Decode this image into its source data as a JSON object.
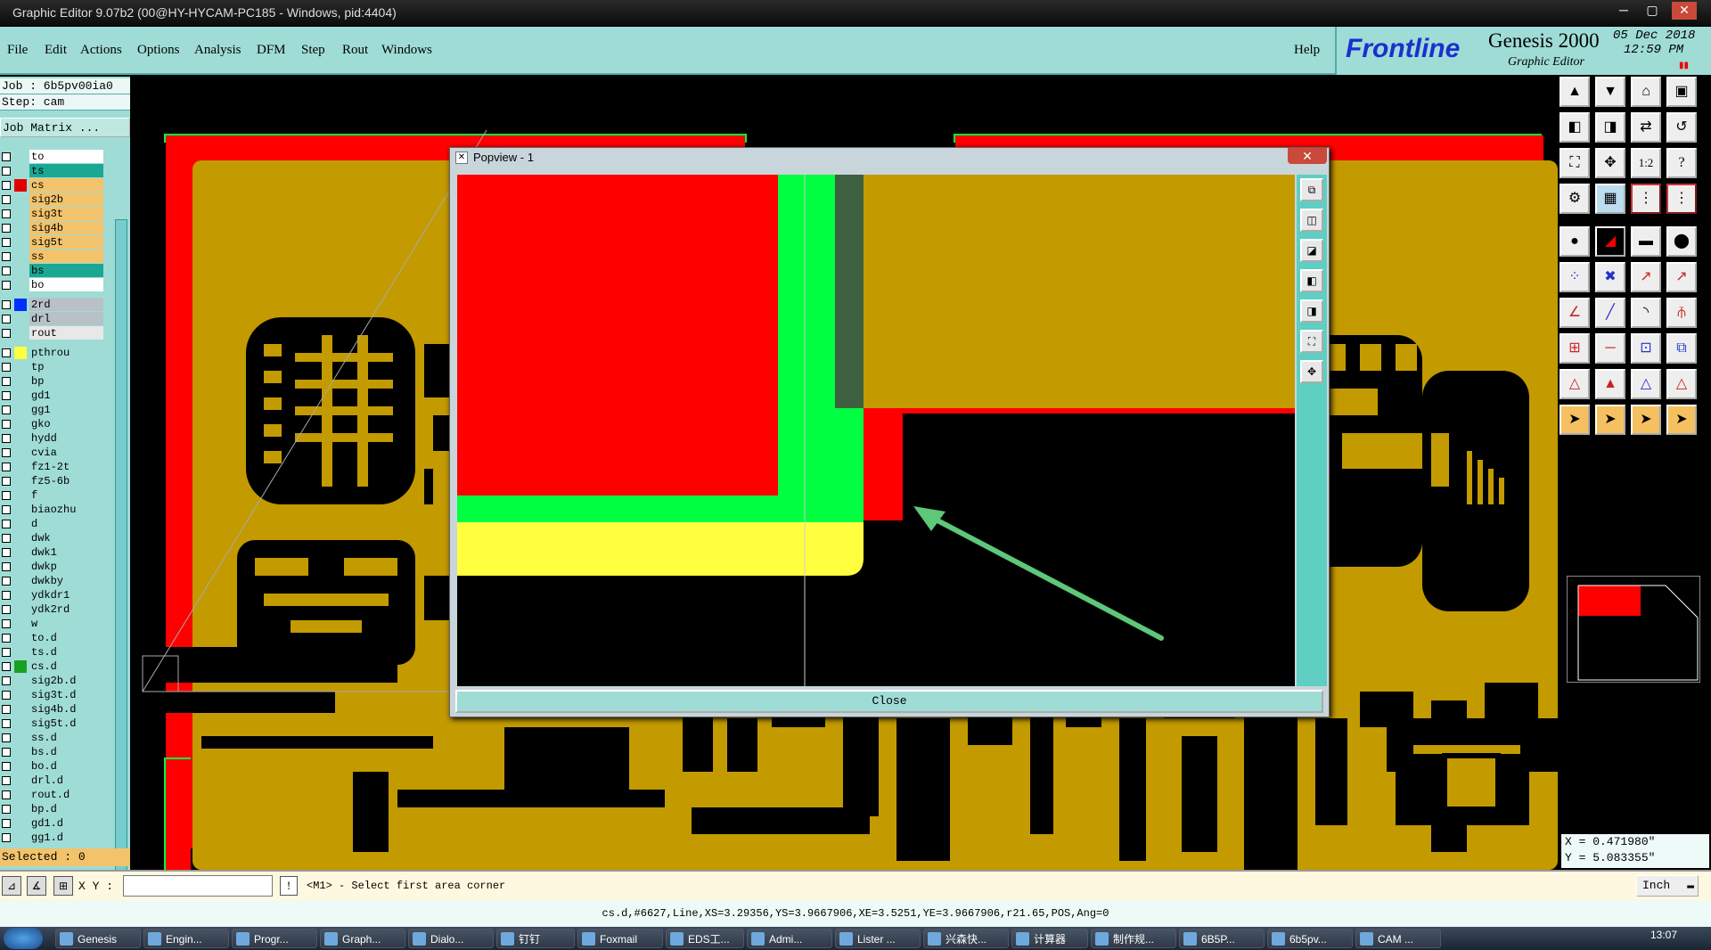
{
  "window": {
    "title": "Graphic Editor 9.07b2 (00@HY-HYCAM-PC185 - Windows, pid:4404)"
  },
  "menu": {
    "items": [
      "File",
      "Edit",
      "Actions",
      "Options",
      "Analysis",
      "DFM",
      "Step",
      "Rout",
      "Windows"
    ],
    "help": "Help"
  },
  "brand": {
    "logo": "Frontline",
    "product": "Genesis 2000",
    "subtitle": "Graphic Editor",
    "date": "05 Dec 2018",
    "time": "12:59 PM"
  },
  "job": {
    "job_line": "Job : 6b5pv00ia0",
    "step_line": "Step: cam",
    "matrix_button": "Job Matrix ..."
  },
  "layers": [
    {
      "name": "to",
      "color": "#ffffff"
    },
    {
      "name": "ts",
      "color": "#1aa894"
    },
    {
      "name": "cs",
      "color": "#f3c36b",
      "mark": "#e00000"
    },
    {
      "name": "sig2b",
      "color": "#f3c36b"
    },
    {
      "name": "sig3t",
      "color": "#f3c36b"
    },
    {
      "name": "sig4b",
      "color": "#f3c36b"
    },
    {
      "name": "sig5t",
      "color": "#f3c36b"
    },
    {
      "name": "ss",
      "color": "#f3c36b"
    },
    {
      "name": "bs",
      "color": "#1aa894"
    },
    {
      "name": "bo",
      "color": "#ffffff"
    },
    {
      "name": "2rd",
      "color": "#b8c0c8",
      "mark": "#0030ff"
    },
    {
      "name": "drl",
      "color": "#b8c0c8"
    },
    {
      "name": "rout",
      "color": "#e8e8e8"
    },
    {
      "name": "pthrou",
      "color": "#9fdcd6",
      "mark": "#ffff40"
    },
    {
      "name": "tp",
      "color": "#9fdcd6"
    },
    {
      "name": "bp",
      "color": "#9fdcd6"
    },
    {
      "name": "gd1",
      "color": "#9fdcd6"
    },
    {
      "name": "gg1",
      "color": "#9fdcd6"
    },
    {
      "name": "gko",
      "color": "#9fdcd6"
    },
    {
      "name": "hydd",
      "color": "#9fdcd6"
    },
    {
      "name": "cvia",
      "color": "#9fdcd6"
    },
    {
      "name": "fz1-2t",
      "color": "#9fdcd6"
    },
    {
      "name": "fz5-6b",
      "color": "#9fdcd6"
    },
    {
      "name": "f",
      "color": "#9fdcd6"
    },
    {
      "name": "biaozhu",
      "color": "#9fdcd6"
    },
    {
      "name": "d",
      "color": "#9fdcd6"
    },
    {
      "name": "dwk",
      "color": "#9fdcd6"
    },
    {
      "name": "dwk1",
      "color": "#9fdcd6"
    },
    {
      "name": "dwkp",
      "color": "#9fdcd6"
    },
    {
      "name": "dwkby",
      "color": "#9fdcd6"
    },
    {
      "name": "ydkdr1",
      "color": "#9fdcd6"
    },
    {
      "name": "ydk2rd",
      "color": "#9fdcd6"
    },
    {
      "name": "w",
      "color": "#9fdcd6"
    },
    {
      "name": "to.d",
      "color": "#9fdcd6"
    },
    {
      "name": "ts.d",
      "color": "#9fdcd6"
    },
    {
      "name": "cs.d",
      "color": "#9fdcd6",
      "mark": "#1aa020"
    },
    {
      "name": "sig2b.d",
      "color": "#9fdcd6"
    },
    {
      "name": "sig3t.d",
      "color": "#9fdcd6"
    },
    {
      "name": "sig4b.d",
      "color": "#9fdcd6"
    },
    {
      "name": "sig5t.d",
      "color": "#9fdcd6"
    },
    {
      "name": "ss.d",
      "color": "#9fdcd6"
    },
    {
      "name": "bs.d",
      "color": "#9fdcd6"
    },
    {
      "name": "bo.d",
      "color": "#9fdcd6"
    },
    {
      "name": "drl.d",
      "color": "#9fdcd6"
    },
    {
      "name": "rout.d",
      "color": "#9fdcd6"
    },
    {
      "name": "bp.d",
      "color": "#9fdcd6"
    },
    {
      "name": "gd1.d",
      "color": "#9fdcd6"
    },
    {
      "name": "gg1.d",
      "color": "#9fdcd6"
    }
  ],
  "selected": "Selected : 0",
  "popview": {
    "title": "Popview - 1",
    "close_label": "Close",
    "close_x": "✕"
  },
  "coords": {
    "x": "X = 0.471980\"",
    "y": "Y = 5.083355\""
  },
  "command": {
    "xy_label": "X Y :",
    "xy_value": "",
    "prompt": "<M1> - Select first area corner",
    "units": "Inch"
  },
  "status": "cs.d,#6627,Line,XS=3.29356,YS=3.9667906,XE=3.5251,YE=3.9667906,r21.65,POS,Ang=0",
  "taskbar": {
    "items": [
      "Genesis",
      "Engin...",
      "Progr...",
      "Graph...",
      "Dialo...",
      "钉钉",
      "Foxmail",
      "EDS工...",
      "Admi...",
      "Lister ...",
      "兴森快...",
      "计算器",
      "制作规...",
      "6B5P...",
      "6b5pv...",
      "CAM ..."
    ],
    "clock": "13:07"
  },
  "colors": {
    "copper": "#c39a00",
    "red": "#ff0000",
    "green": "#00ff40",
    "yellow": "#ffff40",
    "panel": "#9fdcd6"
  }
}
